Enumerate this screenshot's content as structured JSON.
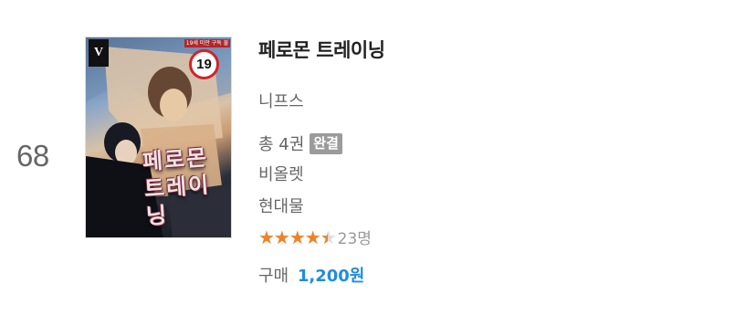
{
  "item": {
    "rank": "68",
    "cover": {
      "logo_text": "V",
      "tagline": "19세 미만 구독 불가",
      "age_rating": "19",
      "title_line1": "페로몬",
      "title_line2": "트레이닝"
    },
    "title": "페로몬 트레이닝",
    "author": "니프스",
    "volumes": "총 4권",
    "status_badge": "완결",
    "publisher": "비올렛",
    "genre": "현대물",
    "rating": {
      "stars_filled_fraction": 0.9,
      "count": "23명"
    },
    "price": {
      "label": "구매",
      "value": "1,200원"
    }
  },
  "colors": {
    "star_filled": "#f08125",
    "star_empty": "#dcdcdc",
    "price_accent": "#1f8ce6",
    "badge_bg": "#9b9b9b",
    "age_ring": "#d3232a"
  }
}
